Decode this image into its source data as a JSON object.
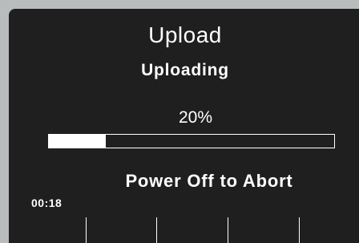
{
  "screen": {
    "title": "Upload",
    "status": "Uploading",
    "progress_text": "20%",
    "progress": 0.2,
    "instruction": "Power Off to Abort",
    "elapsed_time": "00:18"
  },
  "colors": {
    "frame": "#b8bcbc",
    "background": "#1f1f1f",
    "foreground": "#ffffff"
  }
}
